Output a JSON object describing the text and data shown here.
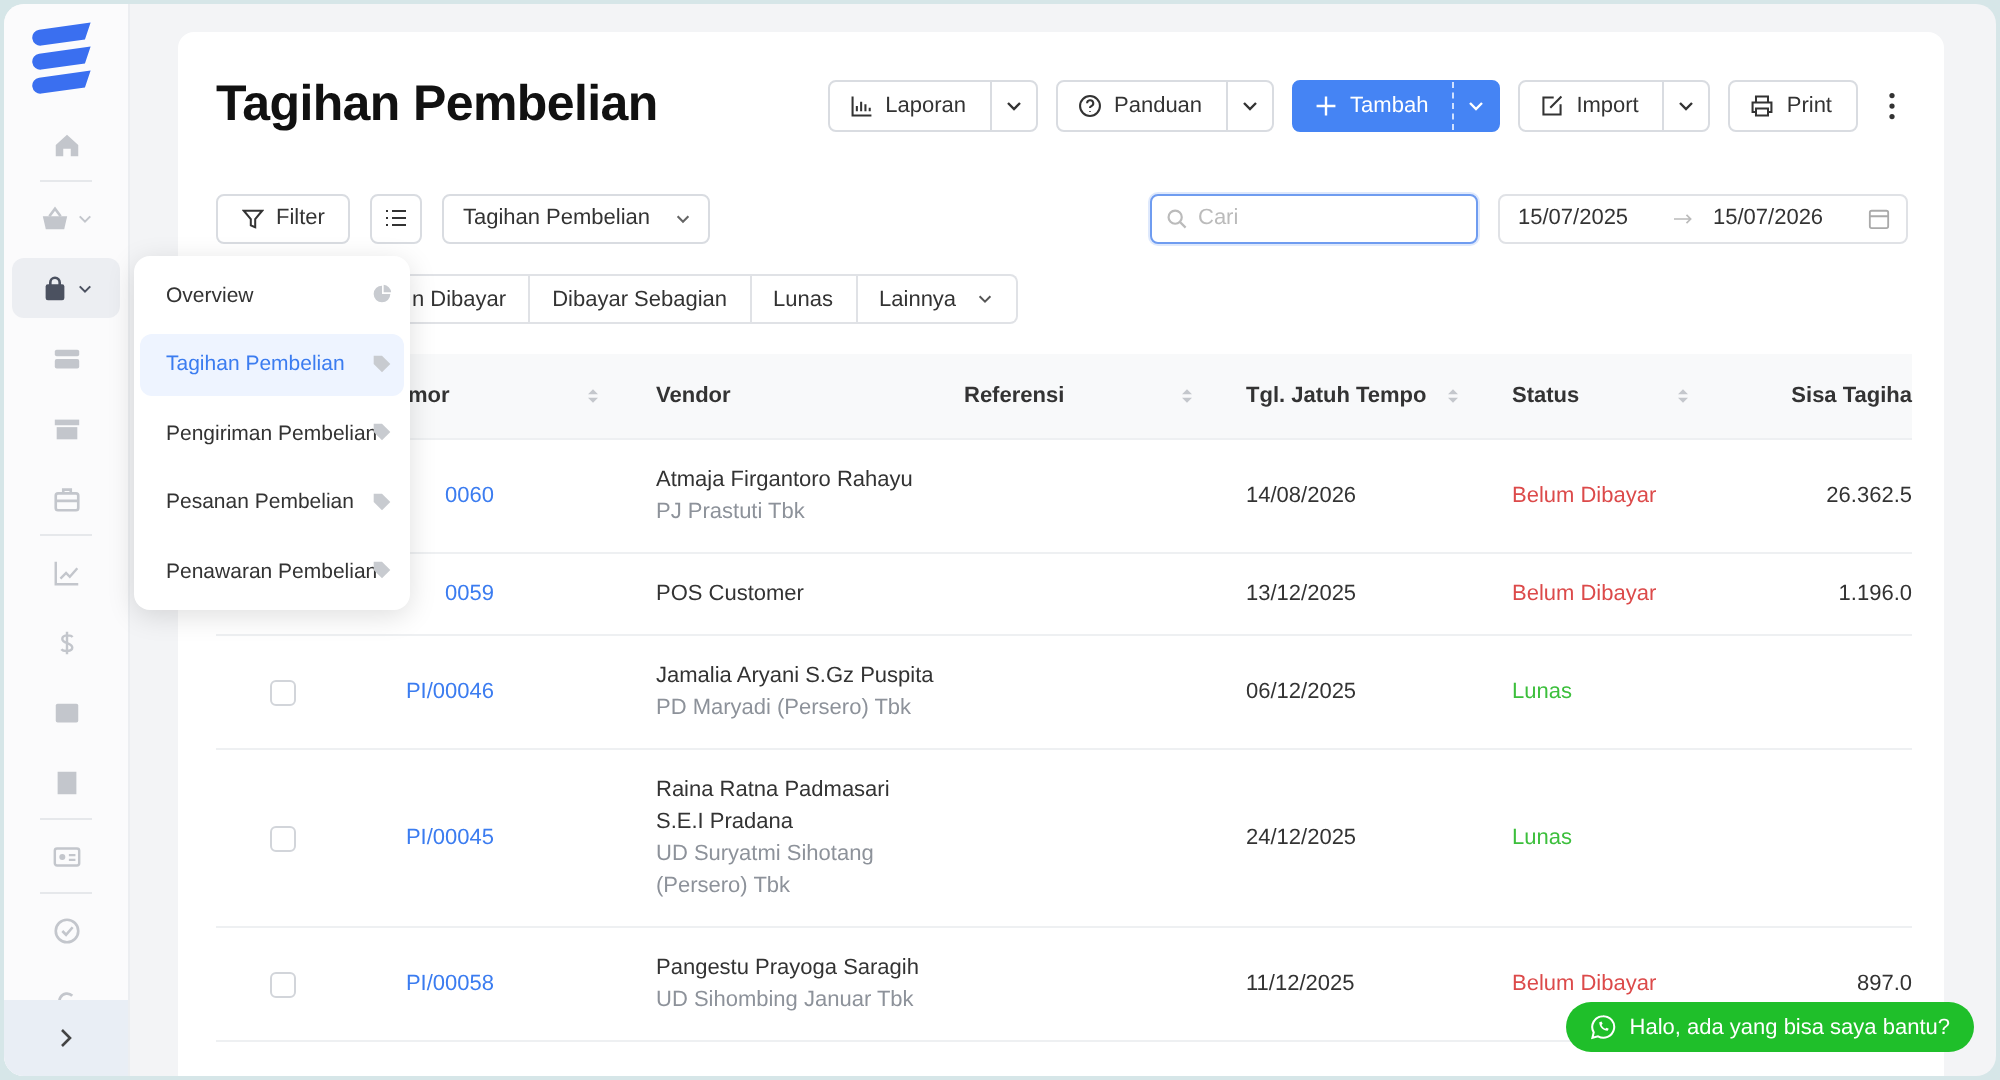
{
  "sidebar": {
    "groups": [
      [
        {
          "kind": "home",
          "selected": false,
          "expandable": false
        }
      ],
      [
        {
          "kind": "basket",
          "selected": false,
          "expandable": true
        },
        {
          "kind": "bag",
          "selected": true,
          "expandable": true
        },
        {
          "kind": "card",
          "selected": false,
          "expandable": false
        },
        {
          "kind": "box",
          "selected": false,
          "expandable": false
        },
        {
          "kind": "briefcase",
          "selected": false,
          "expandable": false
        }
      ],
      [
        {
          "kind": "chart",
          "selected": false,
          "expandable": false
        },
        {
          "kind": "dollar",
          "selected": false,
          "expandable": false
        },
        {
          "kind": "table",
          "selected": false,
          "expandable": false
        },
        {
          "kind": "building",
          "selected": false,
          "expandable": false
        }
      ],
      [
        {
          "kind": "idcard",
          "selected": false,
          "expandable": false
        }
      ],
      [
        {
          "kind": "check",
          "selected": false,
          "expandable": false
        },
        {
          "kind": "cycle",
          "selected": false,
          "expandable": false
        }
      ]
    ]
  },
  "page_title": "Tagihan Pembelian",
  "toolbar": [
    {
      "label": "Laporan",
      "kind": "chart",
      "split": true,
      "primary": false
    },
    {
      "label": "Panduan",
      "kind": "help",
      "split": true,
      "primary": false
    },
    {
      "label": "Tambah",
      "kind": "plus",
      "split": true,
      "primary": true
    },
    {
      "label": "Import",
      "kind": "edit",
      "split": true,
      "primary": false
    },
    {
      "label": "Print",
      "kind": "printer",
      "split": false,
      "primary": false
    }
  ],
  "filter_button": {
    "label": "Filter"
  },
  "view_select": {
    "value": "Tagihan Pembelian"
  },
  "search": {
    "placeholder": "Cari",
    "focused": true
  },
  "date_range": {
    "from": "15/07/2025",
    "to": "15/07/2026"
  },
  "status_tabs": [
    {
      "label": "n Dibayar",
      "selected": false,
      "has_menu": false
    },
    {
      "label": "Dibayar Sebagian",
      "selected": false,
      "has_menu": false
    },
    {
      "label": "Lunas",
      "selected": false,
      "has_menu": false
    },
    {
      "label": "Lainnya",
      "selected": false,
      "has_menu": true
    }
  ],
  "table": {
    "columns": [
      {
        "label": "mor",
        "sortable": true
      },
      {
        "label": "Vendor",
        "sortable": false
      },
      {
        "label": "Referensi",
        "sortable": true
      },
      {
        "label": "Tgl. Jatuh Tempo",
        "sortable": true
      },
      {
        "label": "Status",
        "sortable": true
      },
      {
        "label": "Sisa Tagiha",
        "sortable": false
      }
    ],
    "rows": [
      {
        "number": "0060",
        "vendor": "Atmaja Firgantoro Rahayu",
        "company": "PJ Prastuti Tbk",
        "due": "14/08/2026",
        "status": {
          "label": "Belum Dibayar",
          "kind": "unpaid"
        },
        "remaining": "26.362.5"
      },
      {
        "number": "0059",
        "vendor": "POS Customer",
        "due": "13/12/2025",
        "status": {
          "label": "Belum Dibayar",
          "kind": "unpaid"
        },
        "remaining": "1.196.0"
      },
      {
        "checked": false,
        "number": "PI/00046",
        "vendor": "Jamalia Aryani S.Gz Puspita",
        "company": "PD Maryadi (Persero) Tbk",
        "due": "06/12/2025",
        "status": {
          "label": "Lunas",
          "kind": "paid"
        }
      },
      {
        "checked": false,
        "number": "PI/00045",
        "vendor": "Raina Ratna Padmasari S.E.I Pradana",
        "company": "UD Suryatmi Sihotang (Persero) Tbk",
        "due": "24/12/2025",
        "status": {
          "label": "Lunas",
          "kind": "paid"
        }
      },
      {
        "checked": false,
        "number": "PI/00058",
        "vendor": "Pangestu Prayoga Saragih",
        "company": "UD Sihombing Januar Tbk",
        "due": "11/12/2025",
        "status": {
          "label": "Belum Dibayar",
          "kind": "unpaid"
        },
        "remaining": "897.0"
      }
    ]
  },
  "submenu": {
    "items": [
      {
        "label": "Overview",
        "kind": "pie",
        "selected": false
      },
      {
        "label": "Tagihan Pembelian",
        "kind": "tag",
        "selected": true
      },
      {
        "label": "Pengiriman Pembelian",
        "kind": "tag",
        "selected": false
      },
      {
        "label": "Pesanan Pembelian",
        "kind": "tag",
        "selected": false
      },
      {
        "label": "Penawaran Pembelian",
        "kind": "tag",
        "selected": false
      }
    ]
  },
  "chat_button": {
    "label": "Halo, ada yang bisa saya bantu?"
  }
}
